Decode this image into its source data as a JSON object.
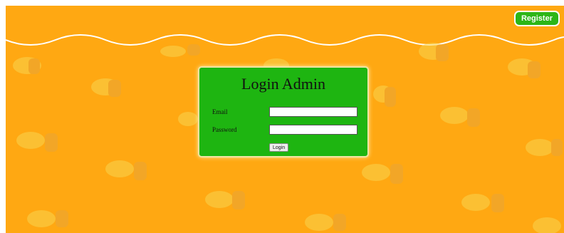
{
  "header": {
    "register_label": "Register"
  },
  "login": {
    "title": "Login Admin",
    "email_label": "Email",
    "email_value": "",
    "password_label": "Password",
    "password_value": "",
    "button_label": "Login"
  },
  "colors": {
    "background": "#ffa812",
    "panel": "#1eb511",
    "register_button": "#2db617"
  }
}
